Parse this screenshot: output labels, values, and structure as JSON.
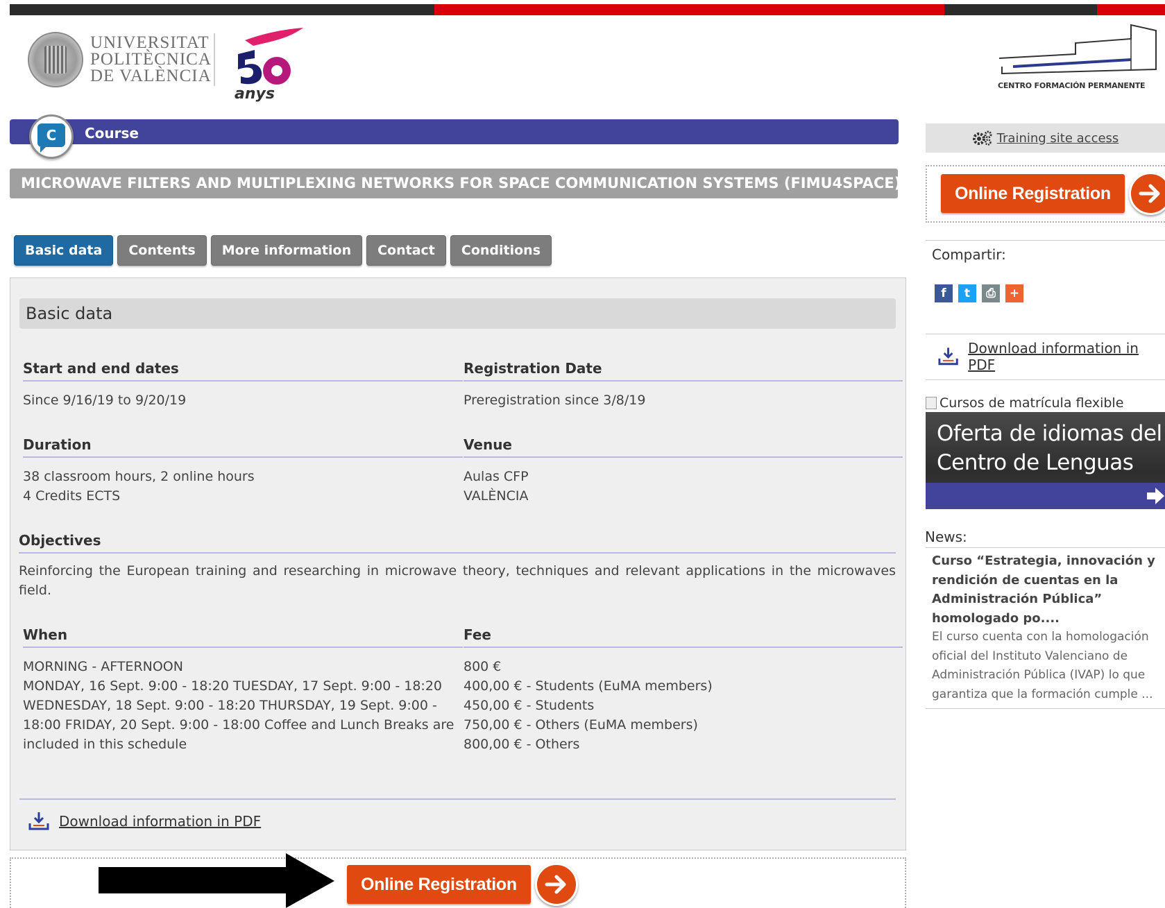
{
  "header": {
    "university_lines": [
      "UNIVERSITAT",
      "POLITÈCNICA",
      "DE VALÈNCIA"
    ],
    "anniversary_text": "anys",
    "center_name": "CENTRO FORMACIÓN PERMANENTE",
    "top_bar_colors": [
      "#2b2b2b",
      "#d9000d",
      "#2b2b2b",
      "#d9000d"
    ]
  },
  "course": {
    "badge_letter": "C",
    "label": "Course",
    "title": "MICROWAVE FILTERS AND MULTIPLEXING NETWORKS FOR SPACE COMMUNICATION SYSTEMS (FIMU4SPACE)"
  },
  "tabs": [
    {
      "label": "Basic data",
      "active": true
    },
    {
      "label": "Contents",
      "active": false
    },
    {
      "label": "More information",
      "active": false
    },
    {
      "label": "Contact",
      "active": false
    },
    {
      "label": "Conditions",
      "active": false
    }
  ],
  "basic": {
    "heading": "Basic data",
    "dates_label": "Start and end dates",
    "dates_value": "Since 9/16/19 to 9/20/19",
    "registration_label": "Registration Date",
    "registration_value": "Preregistration since 3/8/19",
    "duration_label": "Duration",
    "duration_lines": [
      "38 classroom hours, 2 online hours",
      "4 Credits ECTS"
    ],
    "venue_label": "Venue",
    "venue_lines": [
      "Aulas CFP",
      "VALÈNCIA"
    ],
    "objectives_label": "Objectives",
    "objectives_text": "Reinforcing the European training and researching in microwave theory, techniques and relevant applications in the microwaves field.",
    "when_label": "When",
    "when_lines": [
      "MORNING - AFTERNOON",
      "MONDAY, 16 Sept. 9:00 - 18:20 TUESDAY, 17 Sept. 9:00 - 18:20",
      "WEDNESDAY, 18 Sept. 9:00 - 18:20 THURSDAY, 19 Sept. 9:00 -",
      "18:00 FRIDAY, 20 Sept. 9:00 - 18:00 Coffee and Lunch Breaks are",
      "included in this schedule"
    ],
    "fee_label": "Fee",
    "fee_lines": [
      "800 €",
      "400,00 € - Students (EuMA members)",
      "450,00 € - Students",
      "750,00 € - Others (EuMA members)",
      "800,00 € - Others"
    ],
    "pdf_link": "Download information in PDF"
  },
  "registration": {
    "button_label": "Online Registration",
    "accent": "#e04a10"
  },
  "sidebar": {
    "access_link": "Training site access",
    "share_label": "Compartir:",
    "share_icons": [
      {
        "name": "facebook-icon",
        "glyph": "f",
        "color": "#3b5998"
      },
      {
        "name": "twitter-icon",
        "glyph": "t",
        "color": "#1da1f2"
      },
      {
        "name": "print-icon",
        "glyph": "⎙",
        "color": "#7a8a8a"
      },
      {
        "name": "more-share-icon",
        "glyph": "+",
        "color": "#f06434"
      }
    ],
    "pdf_link": "Download information in PDF",
    "banner_alt": "Cursos de matrícula flexible",
    "banner_lines": [
      "Oferta de idiomas del",
      "Centro de Lenguas"
    ],
    "news_label": "News:",
    "news_title": "Curso “Estrategia, innovación y rendición de cuentas en la Administración Pública” homologado po....",
    "news_body": "El curso cuenta con la homologación oficial del Instituto Valenciano de Administración Pública (IVAP) lo que garantiza que la formación cumple ..."
  }
}
